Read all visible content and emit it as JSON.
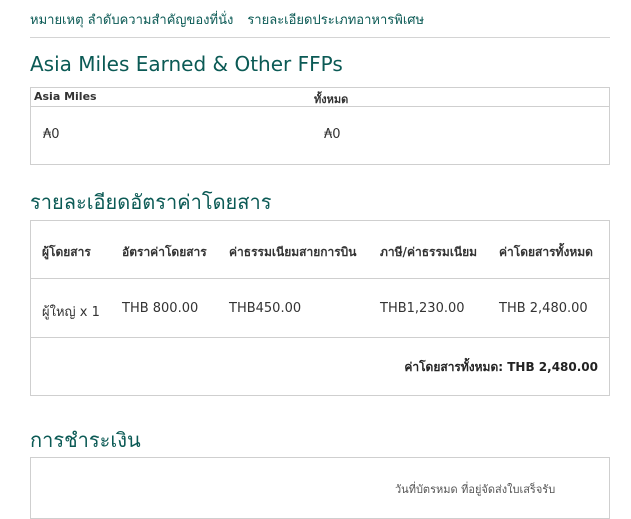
{
  "nav": {
    "link1": "หมายเหตุ ลำดับความสำคัญของที่นั่ง",
    "link2": "รายละเอียดประเภทอาหารพิเศษ"
  },
  "miles": {
    "title": "Asia Miles Earned & Other FFPs",
    "col1": "Asia Miles",
    "col2": "ทั้งหมด",
    "val1": "₳0",
    "val2": "₳0"
  },
  "fare": {
    "title": "รายละเอียดอัตราค่าโดยสาร",
    "headers": [
      "ผู้โดยสาร",
      "อัตราค่าโดยสาร",
      "ค่าธรรมเนียมสายการบิน",
      "ภาษี/ค่าธรรมเนียม",
      "ค่าโดยสารทั้งหมด"
    ],
    "row": [
      "ผู้ใหญ่ x 1",
      "THB 800.00",
      "THB450.00",
      "THB1,230.00",
      "THB 2,480.00"
    ],
    "total": "ค่าโดยสารทั้งหมด: THB 2,480.00"
  },
  "payment": {
    "title": "การชำระเงิน",
    "partial": "วันที่บัตรหมด   ที่อยู่จัดส่งใบเสร็จรับ"
  }
}
